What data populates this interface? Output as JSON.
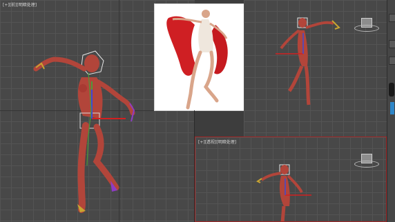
{
  "viewports": {
    "front": {
      "label": "[+][前][明暗处理]"
    },
    "perspective": {
      "label": "[+][透视][明暗处理]"
    }
  },
  "reference_photo": {
    "description_hidden": ""
  },
  "colors": {
    "viewport_bg": "#484848",
    "grid_line": "#545454",
    "active_border": "#a12626",
    "figure_skin": "#b2453a",
    "bone_green": "#4e9a3a",
    "axis_red": "#d22020",
    "axis_blue": "#3c4bd6"
  },
  "icons": [
    "viewcube-icon",
    "viewcube-icon",
    "command-panel-icon"
  ]
}
